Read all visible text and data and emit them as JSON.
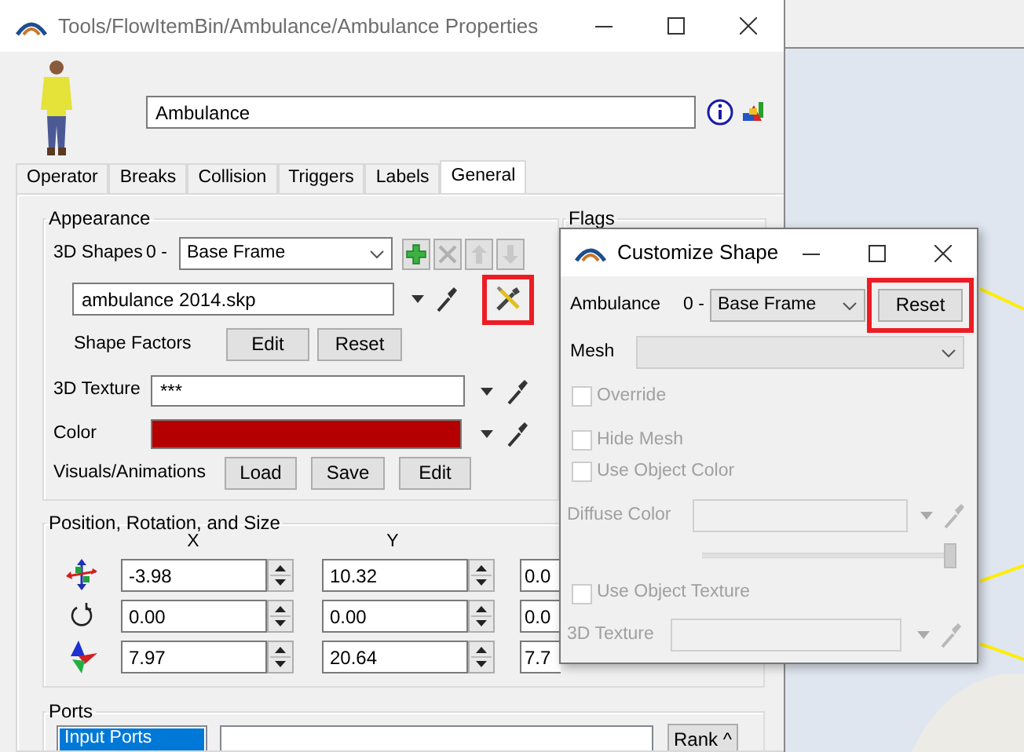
{
  "window": {
    "title": "Tools/FlowItemBin/Ambulance/Ambulance  Properties"
  },
  "name_field": {
    "value": "Ambulance"
  },
  "tabs": [
    {
      "label": "Operator",
      "selected": false
    },
    {
      "label": "Breaks",
      "selected": false
    },
    {
      "label": "Collision",
      "selected": false
    },
    {
      "label": "Triggers",
      "selected": false
    },
    {
      "label": "Labels",
      "selected": false
    },
    {
      "label": "General",
      "selected": true
    }
  ],
  "appearance": {
    "title": "Appearance",
    "shapes_label": "3D Shapes",
    "shape_index": "0 -",
    "shape_select": "Base Frame",
    "shape_file": "ambulance 2014.skp",
    "customize_highlighted": true,
    "shape_factors_label": "Shape Factors",
    "shape_factors_buttons": [
      "Edit",
      "Reset"
    ],
    "texture_label": "3D Texture",
    "texture_value": "***",
    "color_label": "Color",
    "color": "#b40000",
    "visuals_label": "Visuals/Animations",
    "visuals_buttons": [
      "Load",
      "Save",
      "Edit"
    ]
  },
  "flags": {
    "title": "Flags"
  },
  "position": {
    "title": "Position, Rotation, and Size",
    "columns": [
      "X",
      "Y"
    ],
    "rows": [
      {
        "kind": "position",
        "values": [
          "-3.98",
          "10.32",
          "0.0"
        ]
      },
      {
        "kind": "rotation",
        "values": [
          "0.00",
          "0.00",
          "0.0"
        ]
      },
      {
        "kind": "size",
        "values": [
          "7.97",
          "20.64",
          "7.7"
        ]
      }
    ]
  },
  "ports": {
    "title": "Ports",
    "list": [
      {
        "label": "Input Ports",
        "selected": true
      }
    ],
    "rank_button": "Rank ^"
  },
  "dialog": {
    "title": "Customize Shape",
    "object_label": "Ambulance",
    "index": "0 -",
    "shape_select": "Base Frame",
    "reset_button": "Reset",
    "reset_highlighted": true,
    "mesh_label": "Mesh",
    "controls": [
      {
        "kind": "checkbox",
        "label": "Override",
        "checked": false,
        "disabled": true
      },
      {
        "kind": "checkbox",
        "label": "Hide Mesh",
        "checked": false,
        "disabled": true
      },
      {
        "kind": "checkbox",
        "label": "Use Object Color",
        "checked": false,
        "disabled": true
      },
      {
        "kind": "color",
        "label": "Diffuse Color",
        "disabled": true
      },
      {
        "kind": "slider",
        "level": 1,
        "disabled": true
      },
      {
        "kind": "checkbox",
        "label": "Use Object Texture",
        "checked": false,
        "disabled": true
      },
      {
        "kind": "texture",
        "label": "3D Texture",
        "disabled": true
      }
    ]
  }
}
